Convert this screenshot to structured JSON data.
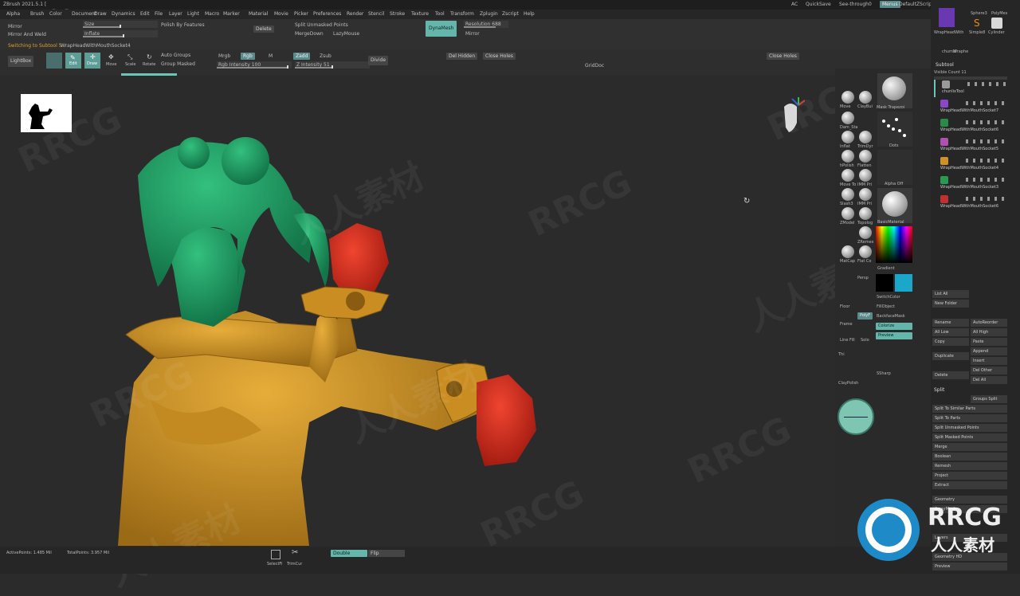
{
  "window": {
    "title": "ZBrush 2021.5.1 ["
  },
  "logo_text": "RRCG",
  "menu": [
    "Alpha",
    "Brush",
    "Color",
    "Document",
    "Draw",
    "Dynamics",
    "Edit",
    "File",
    "Layer",
    "Light",
    "Macro",
    "Marker",
    "Material",
    "Movie",
    "Picker",
    "Preferences",
    "Render",
    "Stencil",
    "Stroke",
    "Texture",
    "Tool",
    "Transform",
    "Zplugin",
    "Zscript",
    "Help"
  ],
  "top_right": {
    "ac": "AC",
    "quicksave": "QuickSave",
    "seethrough": "See-through",
    "seethrough_val": "0",
    "menus": "Menus",
    "script": "DefaultZScript"
  },
  "toolbar1": {
    "mirror": "Mirror",
    "mirror_weld": "Mirror And Weld",
    "size": "Size",
    "inflate": "Inflate",
    "polish_features": "Polish By Features",
    "delete": "Delete",
    "split_unmasked": "Split Unmasked Points",
    "merge_down": "MergeDown",
    "lazy_mouse": "LazyMouse",
    "dynamesh": "DynaMesh",
    "resolution": "Resolution 688",
    "mirror2": "Mirror",
    "subtool_status": "Switching to Subtool 5",
    "subtool_name": "WrapHeadWithMouthSocket4"
  },
  "toolbar2": {
    "lightbox": "LightBox",
    "edit": "Edit",
    "draw": "Draw",
    "move": "Move",
    "scale": "Scale",
    "rotate": "Rotate",
    "auto_groups": "Auto Groups",
    "group_masked": "Group Masked",
    "mrgb": "Mrgb",
    "rgb": "Rgb",
    "m": "M",
    "rgb_intensity": "Rgb Intensity 100",
    "zadd": "Zadd",
    "zsub": "Zsub",
    "z_intensity": "Z Intensity 51",
    "divide": "Divide",
    "del_hidden": "Del Hidden",
    "close_holes": "Close Holes",
    "close_holes2": "Close Holes",
    "griddoc": "GridDoc"
  },
  "brushes": [
    {
      "label": "Move"
    },
    {
      "label": "ClayBui"
    },
    {
      "label": "Dam_Sta"
    },
    {
      "label": "Inflat"
    },
    {
      "label": "TrimDyr"
    },
    {
      "label": "hPolish"
    },
    {
      "label": "Flatten"
    },
    {
      "label": "Move To"
    },
    {
      "label": "IMM Pri"
    },
    {
      "label": "Slash3"
    },
    {
      "label": "IMM Pri"
    },
    {
      "label": "ZModel"
    },
    {
      "label": "Topolog"
    },
    {
      "label": "ZRemes"
    },
    {
      "label": "MatCap"
    },
    {
      "label": "Flat Co"
    }
  ],
  "brush_panel": {
    "mask_trapezoid": "Mask Trapezoi",
    "dots": "Dots",
    "alpha_off": "Alpha Off",
    "basic_material": "BasicMaterial",
    "gradient": "Gradient",
    "switch_color": "SwitchColor",
    "fill_object": "FillObject",
    "backface_mask": "BackfaceMask",
    "colorize": "Colorize",
    "preview": "Preview",
    "thi": "Thi",
    "clay_polish": "ClayPolish",
    "sharp": "SSharp",
    "persp": "Persp",
    "floor": "Floor",
    "frame": "Frame",
    "line_fill": "Line Fill",
    "poly": "PolyF",
    "solo": "Solo",
    "main_color": "#000000",
    "secondary_color": "#1aa7c9"
  },
  "right_panel": {
    "tools_top": [
      "WrapHeadWith",
      "Sphere3",
      "PolyMes",
      "Simple8",
      "Cylinder",
      "chumbi",
      "Wraphe"
    ],
    "subtool_header": "Subtool",
    "visible_count": "Visible Count 11",
    "subtools": [
      {
        "name": "chunlixTool",
        "color": "#9a9a9a"
      },
      {
        "name": "WrapHeadWithMouthSocket7",
        "color": "#8a48c8"
      },
      {
        "name": "WrapHeadWithMouthSocket6",
        "color": "#2a8a4a"
      },
      {
        "name": "WrapHeadWithMouthSocket5",
        "color": "#b050b0"
      },
      {
        "name": "WrapHeadWithMouthSocket4",
        "color": "#d09028"
      },
      {
        "name": "WrapHeadWithMouthSocket3",
        "color": "#2a9a50"
      },
      {
        "name": "WrapHeadWithMouthSocket6",
        "color": "#c03030"
      }
    ],
    "list_all": "List All",
    "new_folder": "New Folder",
    "rename": "Rename",
    "auto_reorder": "AutoReorder",
    "all_low": "All Low",
    "all_high": "All High",
    "copy": "Copy",
    "paste": "Paste",
    "append": "Append",
    "duplicate": "Duplicate",
    "insert": "Insert",
    "delete": "Delete",
    "del_other": "Del Other",
    "del_all": "Del All",
    "split_header": "Split",
    "groups_split": "Groups Split",
    "split_similar": "Split To Similar Parts",
    "split_parts": "Split To Parts",
    "split_unmasked": "Split Unmasked Points",
    "split_masked": "Split Masked Points",
    "merge": "Merge",
    "boolean": "Boolean",
    "remesh": "Remesh",
    "project": "Project",
    "extract": "Extract",
    "geometry": "Geometry",
    "arraymesh": "ArrayMesh",
    "layers": "Layers",
    "geometry_hd": "Geometry HD",
    "preview": "Preview"
  },
  "bottom": {
    "active_points": "ActivePoints: 1.485 Mil",
    "total_points": "TotalPoints: 3.957 Mil",
    "select_fi": "SelectFi",
    "trim_curv": "TrimCur",
    "double": "Double",
    "flip": "Flip"
  },
  "watermark_text": "RRCG",
  "watermark_cn": "人人素材",
  "colors": {
    "hair": "#22a36a",
    "skin": "#d79a2a",
    "gloves": "#d8301f",
    "accent": "#64b5aa"
  }
}
